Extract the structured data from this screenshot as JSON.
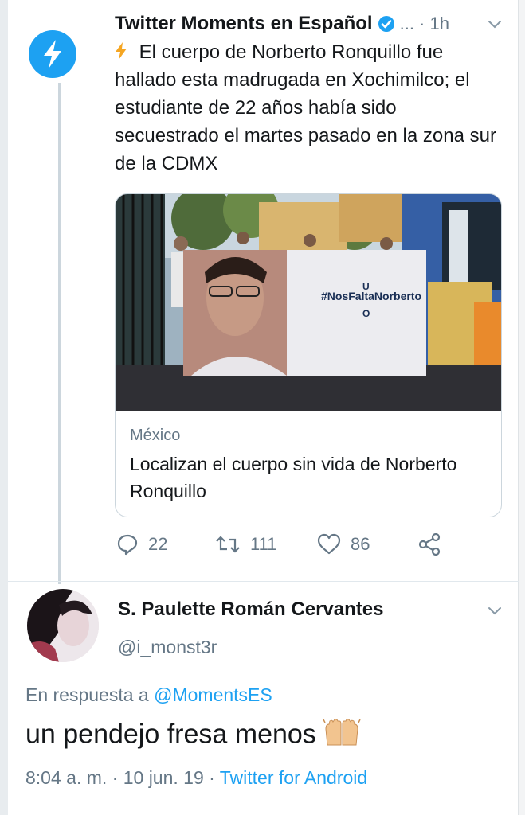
{
  "tweet": {
    "author": "Twitter Moments en Español",
    "meta": "... · 1h",
    "text": "El cuerpo de Norberto Ronquillo fue hallado esta madrugada en Xochimilco; el estudiante de 22 años había sido secuestrado el martes pasado en la zona sur de la CDMX",
    "card": {
      "banner_hashtag": "#NosFaltaNorberto",
      "banner_letter_top": "U",
      "banner_letter_bottom": "O",
      "domain": "México",
      "title": "Localizan el cuerpo sin vida de Norberto Ronquillo"
    },
    "actions": {
      "replies": "22",
      "retweets": "111",
      "likes": "86"
    }
  },
  "reply": {
    "name": "S. Paulette Román Cervantes",
    "handle": "@i_monst3r",
    "in_reply_prefix": "En respuesta a",
    "in_reply_mention": "@MomentsES",
    "text": "un pendejo fresa menos",
    "time": "8:04 a. m. · 10 jun. 19 ·",
    "source": "Twitter for Android"
  },
  "colors": {
    "accent": "#1da1f2",
    "secondary_text": "#657786",
    "primary_text": "#14171a",
    "bolt": "#f5a623"
  }
}
